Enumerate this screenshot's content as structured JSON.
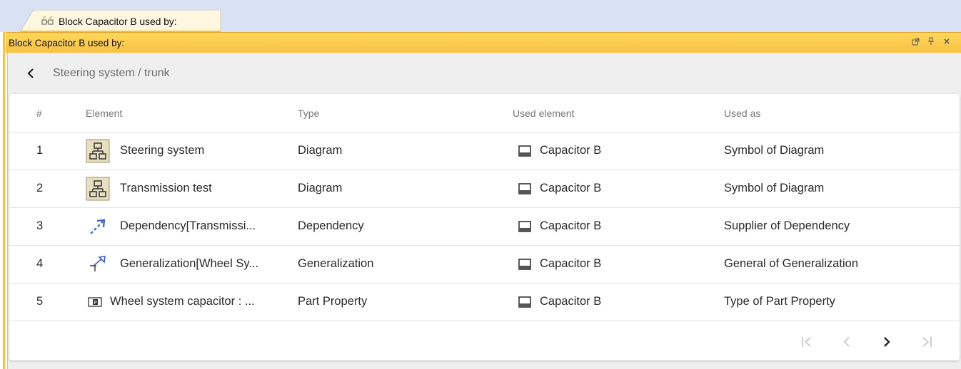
{
  "tab": {
    "label": "Block Capacitor B used by:"
  },
  "titlebar": {
    "title": "Block Capacitor B used by:"
  },
  "breadcrumb": {
    "path": "Steering system / trunk"
  },
  "table": {
    "headers": {
      "num": "#",
      "element": "Element",
      "type": "Type",
      "used_element": "Used element",
      "used_as": "Used as"
    },
    "rows": [
      {
        "num": "1",
        "icon": "diagram-icon",
        "element": "Steering system",
        "type": "Diagram",
        "used_element": "Capacitor B",
        "used_as": "Symbol of Diagram"
      },
      {
        "num": "2",
        "icon": "diagram-icon",
        "element": "Transmission test",
        "type": "Diagram",
        "used_element": "Capacitor B",
        "used_as": "Symbol of Diagram"
      },
      {
        "num": "3",
        "icon": "dependency-icon",
        "element": "Dependency[Transmissi...",
        "type": "Dependency",
        "used_element": "Capacitor B",
        "used_as": "Supplier of Dependency"
      },
      {
        "num": "4",
        "icon": "generalization-icon",
        "element": "Generalization[Wheel Sy...",
        "type": "Generalization",
        "used_element": "Capacitor B",
        "used_as": "General of Generalization"
      },
      {
        "num": "5",
        "icon": "part-property-icon",
        "element": "Wheel system capacitor : ...",
        "type": "Part Property",
        "used_element": "Capacitor B",
        "used_as": "Type of Part Property"
      }
    ]
  },
  "colors": {
    "titlebar": "#f6c245",
    "tabstrip": "#d9e2f2",
    "pane_bg": "#efefef",
    "accent_blue": "#3a5fc8"
  }
}
